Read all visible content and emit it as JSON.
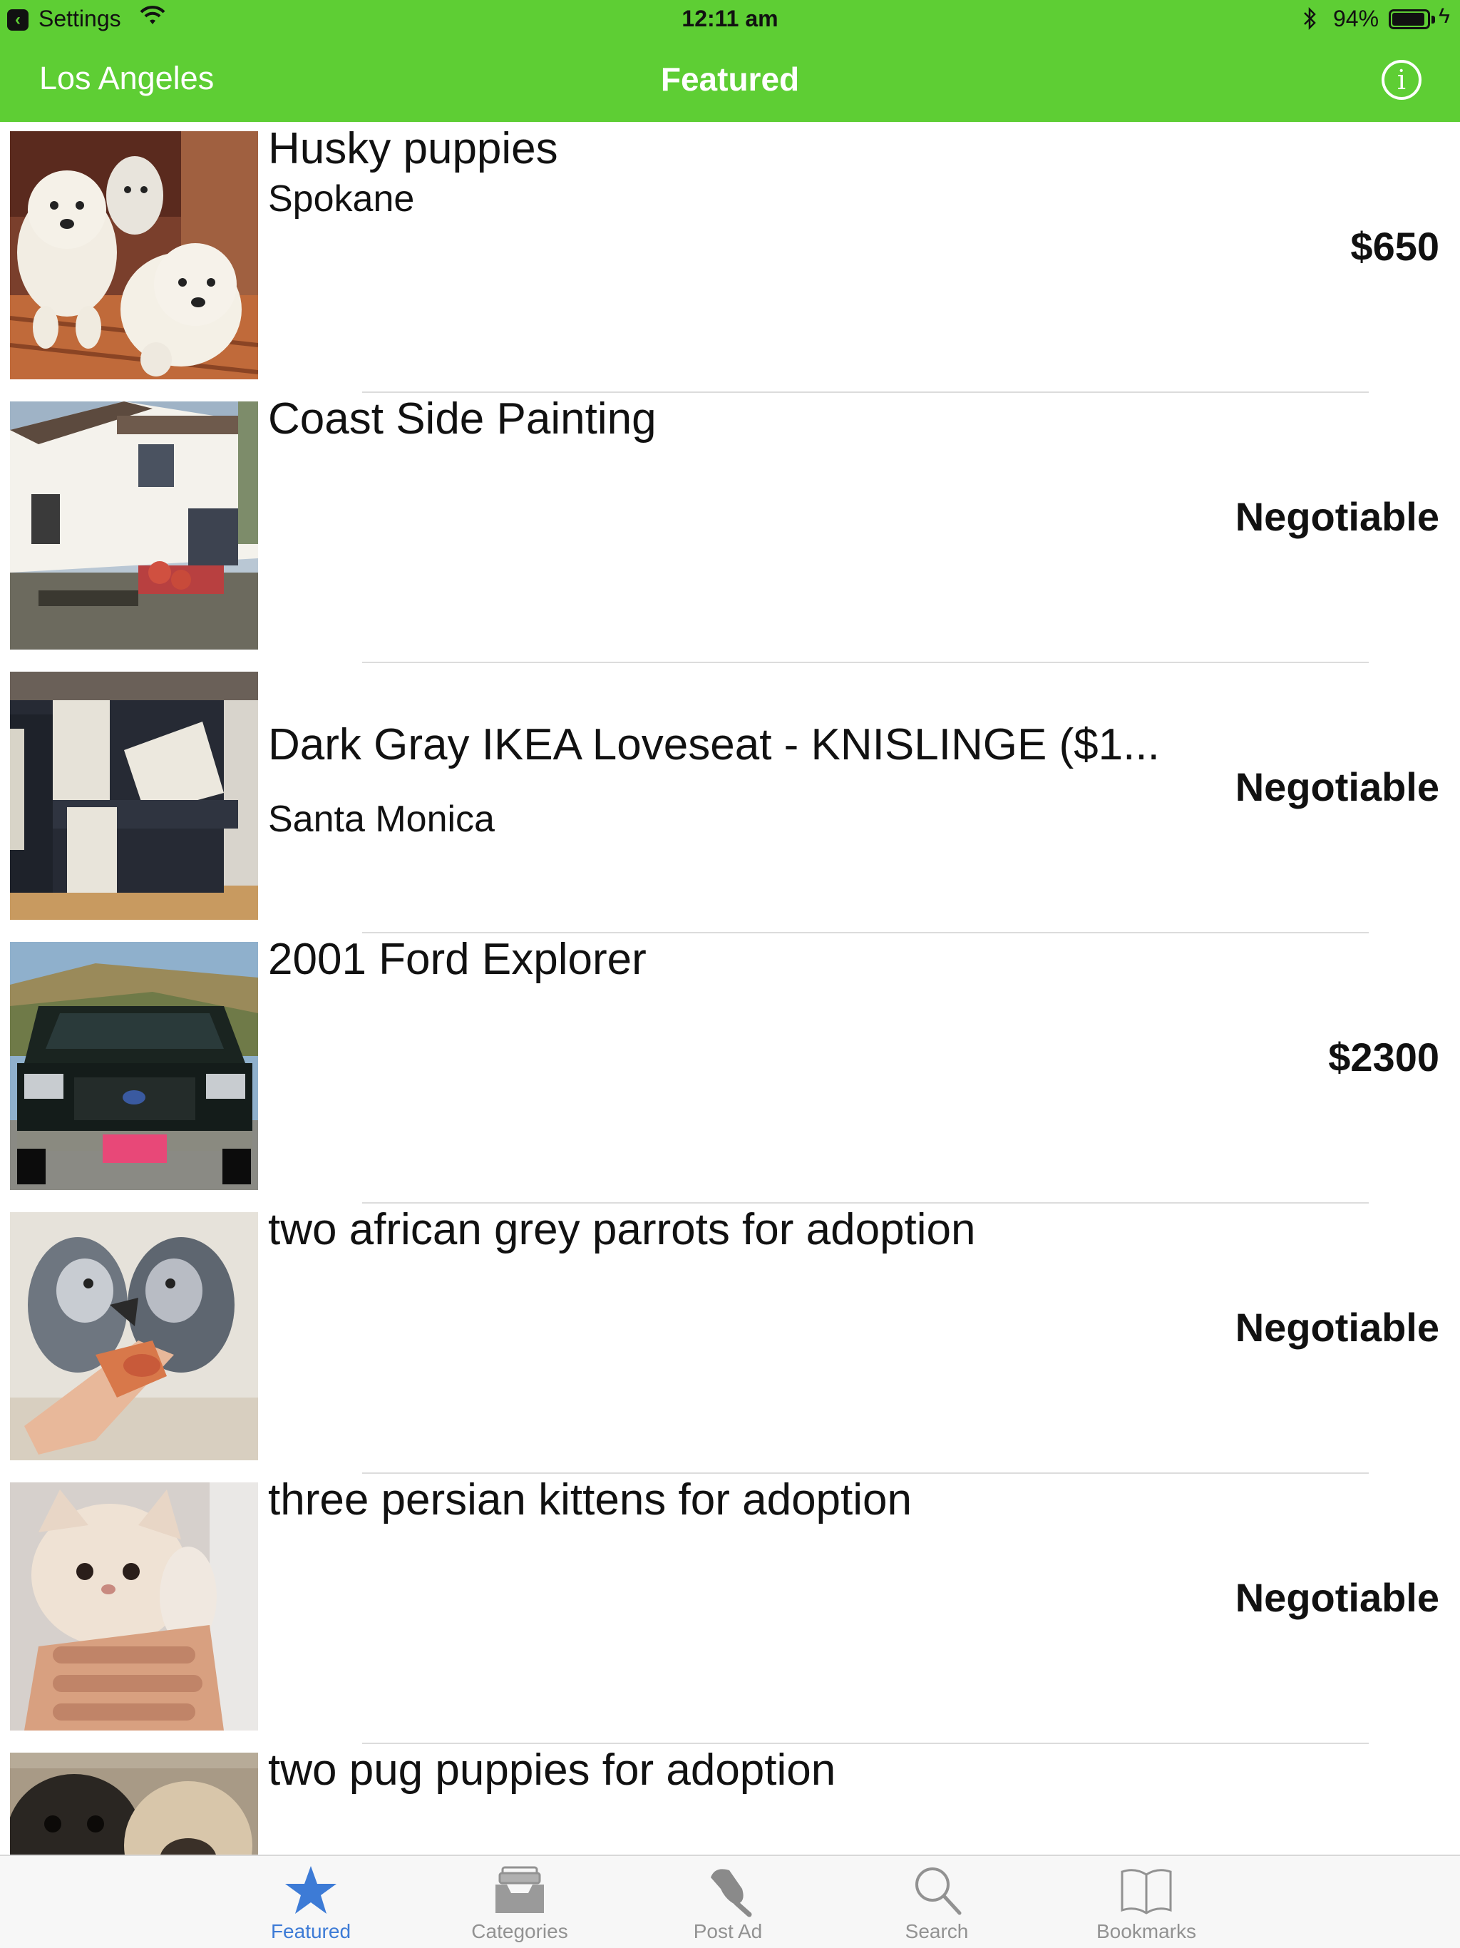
{
  "status_bar": {
    "back_app": "Settings",
    "time": "12:11 am",
    "battery_percent_label": "94%",
    "battery_level": 0.94
  },
  "nav": {
    "location": "Los Angeles",
    "title": "Featured",
    "info_icon": "info-icon"
  },
  "listings": [
    {
      "title": "Husky puppies",
      "location": "Spokane",
      "price": "$650",
      "thumb": "husky-puppies-photo"
    },
    {
      "title": "Coast Side Painting",
      "location": "",
      "price": "Negotiable",
      "thumb": "house-photo"
    },
    {
      "title": "Dark Gray IKEA Loveseat - KNISLINGE ($1...",
      "location": "Santa Monica",
      "price": "Negotiable",
      "thumb": "loveseat-photo"
    },
    {
      "title": "2001 Ford Explorer",
      "location": "",
      "price": "$2300",
      "thumb": "suv-photo"
    },
    {
      "title": "two african grey parrots for adoption",
      "location": "",
      "price": "Negotiable",
      "thumb": "parrots-photo"
    },
    {
      "title": "three persian kittens for adoption",
      "location": "",
      "price": "Negotiable",
      "thumb": "kitten-photo"
    },
    {
      "title": "two pug puppies for adoption",
      "location": "",
      "price": "",
      "thumb": "pug-photo"
    }
  ],
  "tabs": [
    {
      "label": "Featured",
      "icon": "star-icon",
      "active": true
    },
    {
      "label": "Categories",
      "icon": "tray-icon",
      "active": false
    },
    {
      "label": "Post Ad",
      "icon": "pin-icon",
      "active": false
    },
    {
      "label": "Search",
      "icon": "search-icon",
      "active": false
    },
    {
      "label": "Bookmarks",
      "icon": "book-icon",
      "active": false
    }
  ],
  "colors": {
    "accent_green": "#5ece34",
    "tab_active": "#3d7bd6",
    "tab_inactive": "#929292"
  }
}
